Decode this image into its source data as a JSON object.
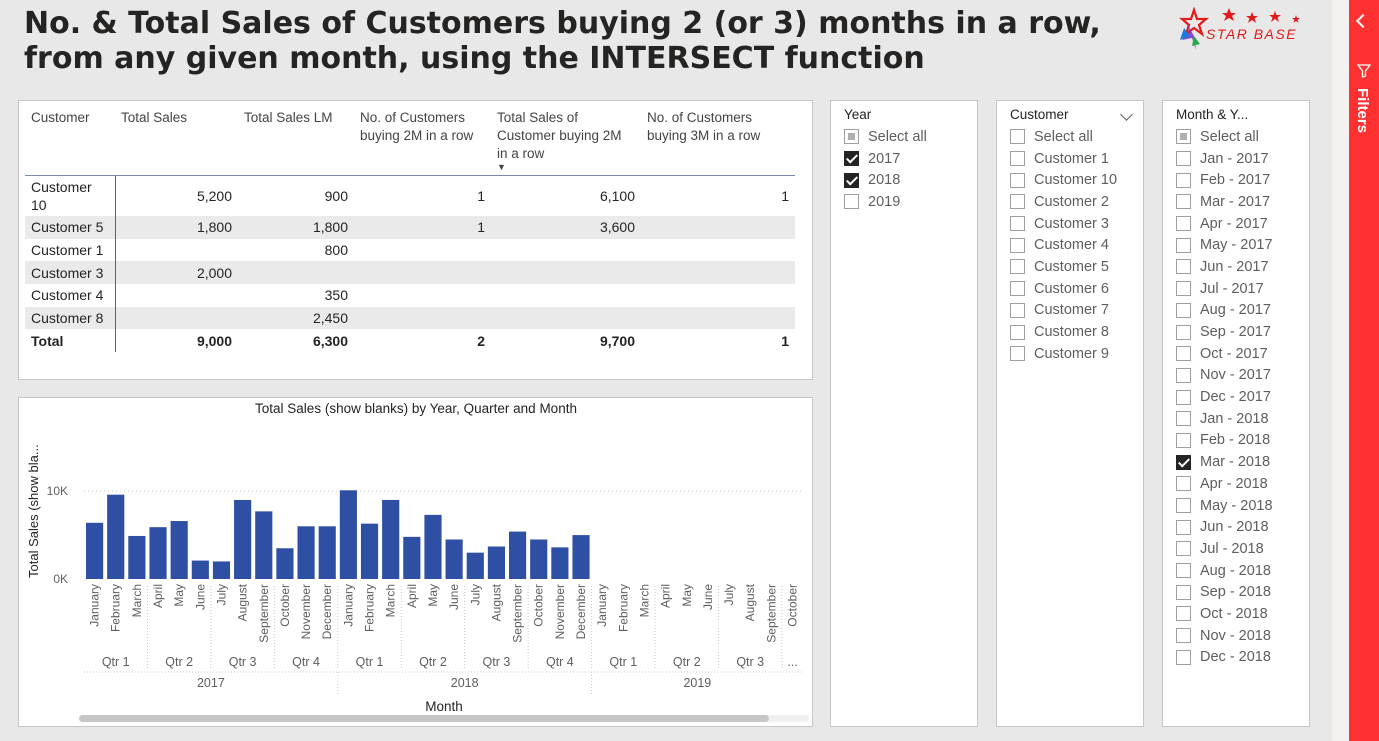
{
  "report": {
    "title_line1": "No. & Total Sales of Customers buying 2 (or 3) months in a row,",
    "title_line2": "from any given month, using the INTERSECT function"
  },
  "logo": {
    "text": "STAR BASE",
    "icon": "stars-logo",
    "color": "#e31a1a"
  },
  "table": {
    "headers": [
      "Customer",
      "Total Sales",
      "Total Sales LM",
      "No. of Customers buying 2M in a row",
      "Total Sales of Customer buying 2M in a row",
      "No. of Customers buying 3M in a row"
    ],
    "rows": [
      {
        "customer": "Customer 10",
        "total_sales": "5,200",
        "total_sales_lm": "900",
        "cust_2m": "1",
        "sales_2m": "6,100",
        "cust_3m": "1"
      },
      {
        "customer": "Customer 5",
        "total_sales": "1,800",
        "total_sales_lm": "1,800",
        "cust_2m": "1",
        "sales_2m": "3,600",
        "cust_3m": ""
      },
      {
        "customer": "Customer 1",
        "total_sales": "",
        "total_sales_lm": "800",
        "cust_2m": "",
        "sales_2m": "",
        "cust_3m": ""
      },
      {
        "customer": "Customer 3",
        "total_sales": "2,000",
        "total_sales_lm": "",
        "cust_2m": "",
        "sales_2m": "",
        "cust_3m": ""
      },
      {
        "customer": "Customer 4",
        "total_sales": "",
        "total_sales_lm": "350",
        "cust_2m": "",
        "sales_2m": "",
        "cust_3m": ""
      },
      {
        "customer": "Customer 8",
        "total_sales": "",
        "total_sales_lm": "2,450",
        "cust_2m": "",
        "sales_2m": "",
        "cust_3m": ""
      }
    ],
    "total": {
      "customer": "Total",
      "total_sales": "9,000",
      "total_sales_lm": "6,300",
      "cust_2m": "2",
      "sales_2m": "9,700",
      "cust_3m": "1"
    },
    "sort_icon": "sort-descending-icon"
  },
  "chart_data": {
    "type": "bar",
    "title": "Total Sales (show blanks) by Year, Quarter and Month",
    "xlabel": "Month",
    "ylabel": "Total Sales (show bla...",
    "ylim": [
      0,
      11500
    ],
    "yticks": [
      "0K",
      "10K"
    ],
    "ytick_values": [
      0,
      10000
    ],
    "color": "#2e4fa3",
    "categories": [
      "January",
      "February",
      "March",
      "April",
      "May",
      "June",
      "July",
      "August",
      "September",
      "October",
      "November",
      "December",
      "January",
      "February",
      "March",
      "April",
      "May",
      "June",
      "July",
      "August",
      "September",
      "October",
      "November",
      "December",
      "January",
      "February",
      "March",
      "April",
      "May",
      "June",
      "July",
      "August",
      "September",
      "October"
    ],
    "values": [
      6400,
      9600,
      4900,
      5900,
      6600,
      2100,
      2000,
      9000,
      7700,
      3500,
      6000,
      6000,
      10100,
      6300,
      9000,
      4800,
      7300,
      4500,
      3000,
      3700,
      5400,
      4500,
      3600,
      5000,
      null,
      null,
      null,
      null,
      null,
      null,
      null,
      null,
      null,
      null
    ],
    "quarters": [
      {
        "label": "Qtr 1",
        "start": 0,
        "count": 3
      },
      {
        "label": "Qtr 2",
        "start": 3,
        "count": 3
      },
      {
        "label": "Qtr 3",
        "start": 6,
        "count": 3
      },
      {
        "label": "Qtr 4",
        "start": 9,
        "count": 3
      },
      {
        "label": "Qtr 1",
        "start": 12,
        "count": 3
      },
      {
        "label": "Qtr 2",
        "start": 15,
        "count": 3
      },
      {
        "label": "Qtr 3",
        "start": 18,
        "count": 3
      },
      {
        "label": "Qtr 4",
        "start": 21,
        "count": 3
      },
      {
        "label": "Qtr 1",
        "start": 24,
        "count": 3
      },
      {
        "label": "Qtr 2",
        "start": 27,
        "count": 3
      },
      {
        "label": "Qtr 3",
        "start": 30,
        "count": 3
      },
      {
        "label": "...",
        "start": 33,
        "count": 1
      }
    ],
    "years": [
      {
        "label": "2017",
        "start": 0,
        "count": 12
      },
      {
        "label": "2018",
        "start": 12,
        "count": 12
      },
      {
        "label": "2019",
        "start": 24,
        "count": 10
      }
    ],
    "grid": true,
    "legend": "none"
  },
  "slicers": {
    "year": {
      "header": "Year",
      "items": [
        {
          "label": "Select all",
          "state": "partial"
        },
        {
          "label": "2017",
          "state": "checked"
        },
        {
          "label": "2018",
          "state": "checked"
        },
        {
          "label": "2019",
          "state": "unchecked"
        }
      ]
    },
    "customer": {
      "header": "Customer",
      "items": [
        {
          "label": "Select all",
          "state": "unchecked"
        },
        {
          "label": "Customer 1",
          "state": "unchecked"
        },
        {
          "label": "Customer 10",
          "state": "unchecked"
        },
        {
          "label": "Customer 2",
          "state": "unchecked"
        },
        {
          "label": "Customer 3",
          "state": "unchecked"
        },
        {
          "label": "Customer 4",
          "state": "unchecked"
        },
        {
          "label": "Customer 5",
          "state": "unchecked"
        },
        {
          "label": "Customer 6",
          "state": "unchecked"
        },
        {
          "label": "Customer 7",
          "state": "unchecked"
        },
        {
          "label": "Customer 8",
          "state": "unchecked"
        },
        {
          "label": "Customer 9",
          "state": "unchecked"
        }
      ]
    },
    "month_year": {
      "header": "Month & Y...",
      "items": [
        {
          "label": "Select all",
          "state": "partial"
        },
        {
          "label": "Jan - 2017",
          "state": "unchecked"
        },
        {
          "label": "Feb - 2017",
          "state": "unchecked"
        },
        {
          "label": "Mar - 2017",
          "state": "unchecked"
        },
        {
          "label": "Apr - 2017",
          "state": "unchecked"
        },
        {
          "label": "May - 2017",
          "state": "unchecked"
        },
        {
          "label": "Jun - 2017",
          "state": "unchecked"
        },
        {
          "label": "Jul - 2017",
          "state": "unchecked"
        },
        {
          "label": "Aug - 2017",
          "state": "unchecked"
        },
        {
          "label": "Sep - 2017",
          "state": "unchecked"
        },
        {
          "label": "Oct - 2017",
          "state": "unchecked"
        },
        {
          "label": "Nov - 2017",
          "state": "unchecked"
        },
        {
          "label": "Dec - 2017",
          "state": "unchecked"
        },
        {
          "label": "Jan - 2018",
          "state": "unchecked"
        },
        {
          "label": "Feb - 2018",
          "state": "unchecked"
        },
        {
          "label": "Mar - 2018",
          "state": "checked"
        },
        {
          "label": "Apr - 2018",
          "state": "unchecked"
        },
        {
          "label": "May - 2018",
          "state": "unchecked"
        },
        {
          "label": "Jun - 2018",
          "state": "unchecked"
        },
        {
          "label": "Jul - 2018",
          "state": "unchecked"
        },
        {
          "label": "Aug - 2018",
          "state": "unchecked"
        },
        {
          "label": "Sep - 2018",
          "state": "unchecked"
        },
        {
          "label": "Oct - 2018",
          "state": "unchecked"
        },
        {
          "label": "Nov - 2018",
          "state": "unchecked"
        },
        {
          "label": "Dec - 2018",
          "state": "unchecked"
        }
      ]
    }
  },
  "filters_pane": {
    "label": "Filters",
    "color": "#ff3030",
    "collapse_icon": "chevron-left-icon",
    "filter_icon": "funnel-icon"
  }
}
